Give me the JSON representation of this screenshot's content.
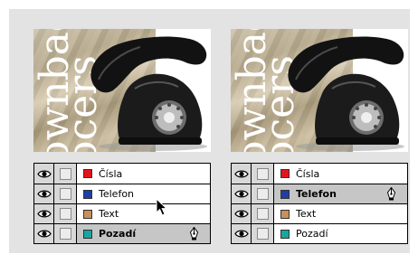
{
  "artwork": {
    "line1": "ownbag",
    "line2": "ocers"
  },
  "panels": [
    {
      "layers": [
        {
          "name": "Čísla",
          "color": "#e2141c",
          "selected": false
        },
        {
          "name": "Telefon",
          "color": "#1f3fa3",
          "selected": false
        },
        {
          "name": "Text",
          "color": "#c8905a",
          "selected": false
        },
        {
          "name": "Pozadí",
          "color": "#19a6a0",
          "selected": true
        }
      ]
    },
    {
      "layers": [
        {
          "name": "Čísla",
          "color": "#e2141c",
          "selected": false
        },
        {
          "name": "Telefon",
          "color": "#1f3fa3",
          "selected": true
        },
        {
          "name": "Text",
          "color": "#c8905a",
          "selected": false
        },
        {
          "name": "Pozadí",
          "color": "#19a6a0",
          "selected": false
        }
      ]
    }
  ],
  "icons": {
    "visibility": "eye-icon",
    "lock": "lock-toggle",
    "active_layer": "pen-icon",
    "pointer": "arrow-cursor-icon"
  }
}
